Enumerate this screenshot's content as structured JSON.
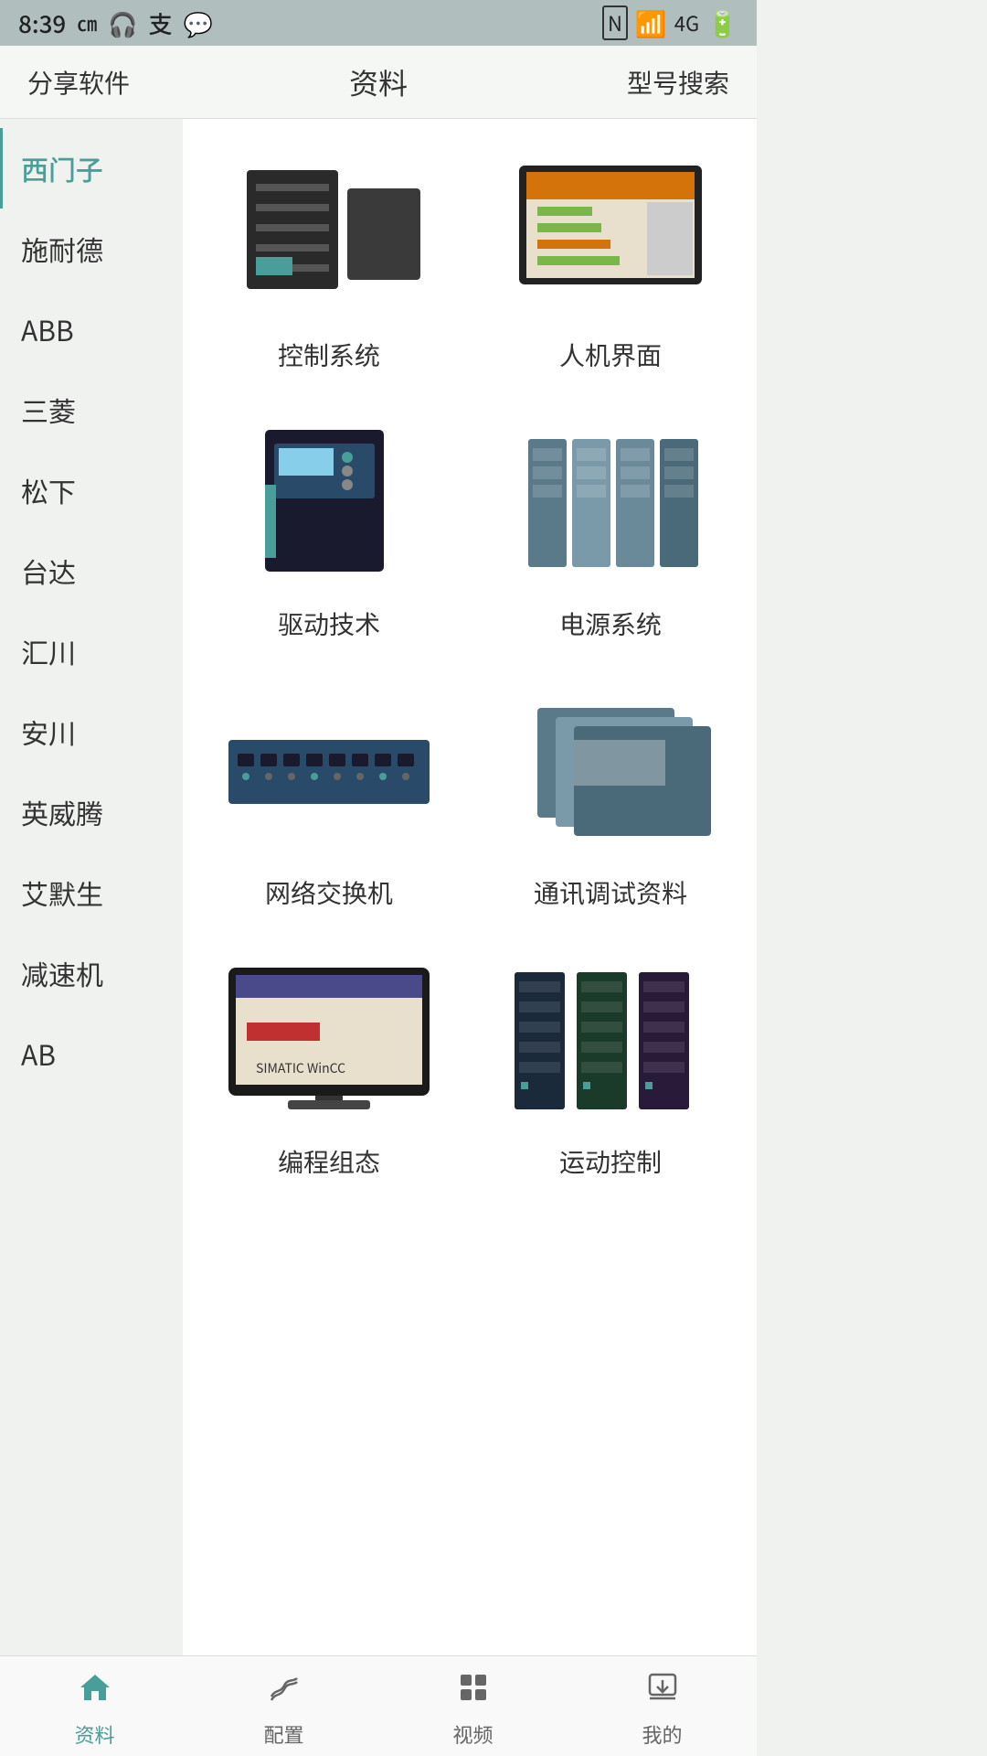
{
  "statusBar": {
    "time": "8:39",
    "icons": [
      "通话",
      "蓝牙",
      "支付宝",
      "聊天",
      "NFC",
      "WiFi",
      "信号",
      "电池"
    ]
  },
  "topNav": {
    "leftBtn": "分享软件",
    "title": "资料",
    "rightBtn": "型号搜索"
  },
  "sidebar": {
    "items": [
      {
        "id": "siemens",
        "label": "西门子",
        "active": true
      },
      {
        "id": "schneider",
        "label": "施耐德",
        "active": false
      },
      {
        "id": "abb",
        "label": "ABB",
        "active": false
      },
      {
        "id": "mitsubishi",
        "label": "三菱",
        "active": false
      },
      {
        "id": "panasonic",
        "label": "松下",
        "active": false
      },
      {
        "id": "delta",
        "label": "台达",
        "active": false
      },
      {
        "id": "inovance",
        "label": "汇川",
        "active": false
      },
      {
        "id": "yaskawa",
        "label": "安川",
        "active": false
      },
      {
        "id": "invt",
        "label": "英威腾",
        "active": false
      },
      {
        "id": "emerson",
        "label": "艾默生",
        "active": false
      },
      {
        "id": "reducer",
        "label": "减速机",
        "active": false
      },
      {
        "id": "ab",
        "label": "AB",
        "active": false
      }
    ]
  },
  "products": [
    {
      "id": "control-system",
      "label": "控制系统",
      "imgType": "control"
    },
    {
      "id": "hmi",
      "label": "人机界面",
      "imgType": "hmi"
    },
    {
      "id": "drive",
      "label": "驱动技术",
      "imgType": "drive"
    },
    {
      "id": "power",
      "label": "电源系统",
      "imgType": "power"
    },
    {
      "id": "network-switch",
      "label": "网络交换机",
      "imgType": "network"
    },
    {
      "id": "comm-debug",
      "label": "通讯调试资料",
      "imgType": "comm"
    },
    {
      "id": "programming",
      "label": "编程组态",
      "imgType": "programming"
    },
    {
      "id": "motion",
      "label": "运动控制",
      "imgType": "motion"
    }
  ],
  "bottomNav": {
    "items": [
      {
        "id": "home",
        "label": "资料",
        "active": true,
        "icon": "home"
      },
      {
        "id": "config",
        "label": "配置",
        "active": false,
        "icon": "chart"
      },
      {
        "id": "video",
        "label": "视频",
        "active": false,
        "icon": "grid"
      },
      {
        "id": "mine",
        "label": "我的",
        "active": false,
        "icon": "download"
      }
    ]
  }
}
